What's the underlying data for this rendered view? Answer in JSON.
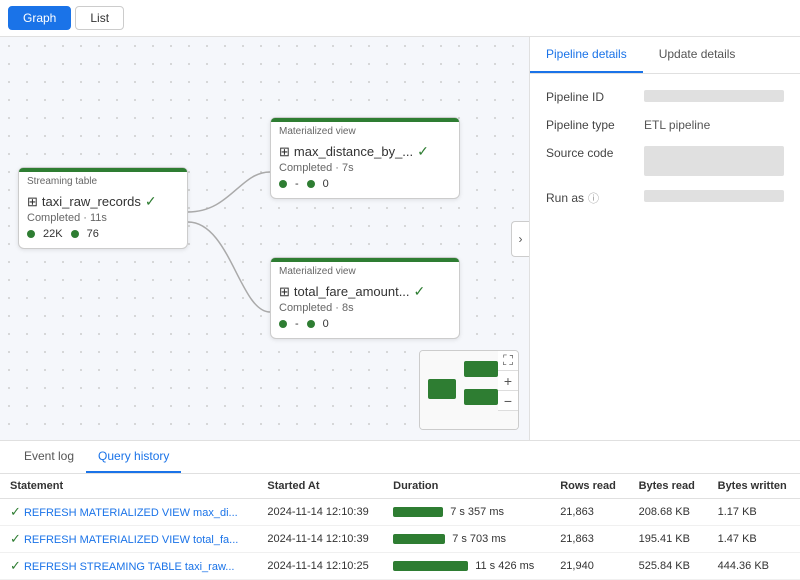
{
  "tabs": {
    "graph": "Graph",
    "list": "List"
  },
  "graph": {
    "nodes": {
      "streaming": {
        "type_label": "Streaming table",
        "name": "taxi_raw_records",
        "status": "Completed · 11s",
        "metric1_value": "22K",
        "metric2_value": "76"
      },
      "mat1": {
        "type_label": "Materialized view",
        "name": "max_distance_by_...",
        "status": "Completed · 7s",
        "metric1_value": "-",
        "metric2_value": "0"
      },
      "mat2": {
        "type_label": "Materialized view",
        "name": "total_fare_amount...",
        "status": "Completed · 8s",
        "metric1_value": "-",
        "metric2_value": "0"
      }
    }
  },
  "right_panel": {
    "tab1": "Pipeline details",
    "tab2": "Update details",
    "pipeline_id_label": "Pipeline ID",
    "pipeline_type_label": "Pipeline type",
    "source_code_label": "Source code",
    "run_as_label": "Run as",
    "pipeline_type_value": "ETL pipeline"
  },
  "bottom": {
    "tab1": "Event log",
    "tab2": "Query history",
    "columns": [
      "Statement",
      "Started At",
      "Duration",
      "Rows read",
      "Bytes read",
      "Bytes written"
    ],
    "rows": [
      {
        "statement": "REFRESH MATERIALIZED VIEW max_di...",
        "started_at": "2024-11-14 12:10:39",
        "duration_text": "7 s 357 ms",
        "duration_bar_width": 50,
        "rows_read": "21,863",
        "bytes_read": "208.68 KB",
        "bytes_written": "1.17 KB"
      },
      {
        "statement": "REFRESH MATERIALIZED VIEW total_fa...",
        "started_at": "2024-11-14 12:10:39",
        "duration_text": "7 s 703 ms",
        "duration_bar_width": 52,
        "rows_read": "21,863",
        "bytes_read": "195.41 KB",
        "bytes_written": "1.47 KB"
      },
      {
        "statement": "REFRESH STREAMING TABLE taxi_raw...",
        "started_at": "2024-11-14 12:10:25",
        "duration_text": "11 s 426 ms",
        "duration_bar_width": 75,
        "rows_read": "21,940",
        "bytes_read": "525.84 KB",
        "bytes_written": "444.36 KB"
      }
    ]
  }
}
